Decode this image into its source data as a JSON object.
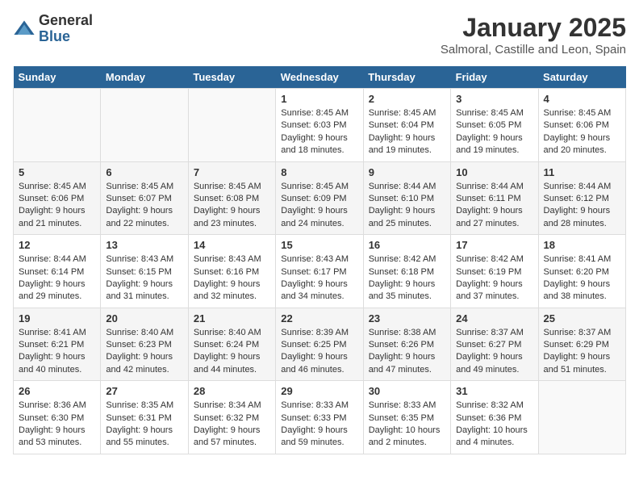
{
  "logo": {
    "general": "General",
    "blue": "Blue"
  },
  "title": "January 2025",
  "location": "Salmoral, Castille and Leon, Spain",
  "days_header": [
    "Sunday",
    "Monday",
    "Tuesday",
    "Wednesday",
    "Thursday",
    "Friday",
    "Saturday"
  ],
  "weeks": [
    [
      {
        "day": "",
        "info": ""
      },
      {
        "day": "",
        "info": ""
      },
      {
        "day": "",
        "info": ""
      },
      {
        "day": "1",
        "info": "Sunrise: 8:45 AM\nSunset: 6:03 PM\nDaylight: 9 hours\nand 18 minutes."
      },
      {
        "day": "2",
        "info": "Sunrise: 8:45 AM\nSunset: 6:04 PM\nDaylight: 9 hours\nand 19 minutes."
      },
      {
        "day": "3",
        "info": "Sunrise: 8:45 AM\nSunset: 6:05 PM\nDaylight: 9 hours\nand 19 minutes."
      },
      {
        "day": "4",
        "info": "Sunrise: 8:45 AM\nSunset: 6:06 PM\nDaylight: 9 hours\nand 20 minutes."
      }
    ],
    [
      {
        "day": "5",
        "info": "Sunrise: 8:45 AM\nSunset: 6:06 PM\nDaylight: 9 hours\nand 21 minutes."
      },
      {
        "day": "6",
        "info": "Sunrise: 8:45 AM\nSunset: 6:07 PM\nDaylight: 9 hours\nand 22 minutes."
      },
      {
        "day": "7",
        "info": "Sunrise: 8:45 AM\nSunset: 6:08 PM\nDaylight: 9 hours\nand 23 minutes."
      },
      {
        "day": "8",
        "info": "Sunrise: 8:45 AM\nSunset: 6:09 PM\nDaylight: 9 hours\nand 24 minutes."
      },
      {
        "day": "9",
        "info": "Sunrise: 8:44 AM\nSunset: 6:10 PM\nDaylight: 9 hours\nand 25 minutes."
      },
      {
        "day": "10",
        "info": "Sunrise: 8:44 AM\nSunset: 6:11 PM\nDaylight: 9 hours\nand 27 minutes."
      },
      {
        "day": "11",
        "info": "Sunrise: 8:44 AM\nSunset: 6:12 PM\nDaylight: 9 hours\nand 28 minutes."
      }
    ],
    [
      {
        "day": "12",
        "info": "Sunrise: 8:44 AM\nSunset: 6:14 PM\nDaylight: 9 hours\nand 29 minutes."
      },
      {
        "day": "13",
        "info": "Sunrise: 8:43 AM\nSunset: 6:15 PM\nDaylight: 9 hours\nand 31 minutes."
      },
      {
        "day": "14",
        "info": "Sunrise: 8:43 AM\nSunset: 6:16 PM\nDaylight: 9 hours\nand 32 minutes."
      },
      {
        "day": "15",
        "info": "Sunrise: 8:43 AM\nSunset: 6:17 PM\nDaylight: 9 hours\nand 34 minutes."
      },
      {
        "day": "16",
        "info": "Sunrise: 8:42 AM\nSunset: 6:18 PM\nDaylight: 9 hours\nand 35 minutes."
      },
      {
        "day": "17",
        "info": "Sunrise: 8:42 AM\nSunset: 6:19 PM\nDaylight: 9 hours\nand 37 minutes."
      },
      {
        "day": "18",
        "info": "Sunrise: 8:41 AM\nSunset: 6:20 PM\nDaylight: 9 hours\nand 38 minutes."
      }
    ],
    [
      {
        "day": "19",
        "info": "Sunrise: 8:41 AM\nSunset: 6:21 PM\nDaylight: 9 hours\nand 40 minutes."
      },
      {
        "day": "20",
        "info": "Sunrise: 8:40 AM\nSunset: 6:23 PM\nDaylight: 9 hours\nand 42 minutes."
      },
      {
        "day": "21",
        "info": "Sunrise: 8:40 AM\nSunset: 6:24 PM\nDaylight: 9 hours\nand 44 minutes."
      },
      {
        "day": "22",
        "info": "Sunrise: 8:39 AM\nSunset: 6:25 PM\nDaylight: 9 hours\nand 46 minutes."
      },
      {
        "day": "23",
        "info": "Sunrise: 8:38 AM\nSunset: 6:26 PM\nDaylight: 9 hours\nand 47 minutes."
      },
      {
        "day": "24",
        "info": "Sunrise: 8:37 AM\nSunset: 6:27 PM\nDaylight: 9 hours\nand 49 minutes."
      },
      {
        "day": "25",
        "info": "Sunrise: 8:37 AM\nSunset: 6:29 PM\nDaylight: 9 hours\nand 51 minutes."
      }
    ],
    [
      {
        "day": "26",
        "info": "Sunrise: 8:36 AM\nSunset: 6:30 PM\nDaylight: 9 hours\nand 53 minutes."
      },
      {
        "day": "27",
        "info": "Sunrise: 8:35 AM\nSunset: 6:31 PM\nDaylight: 9 hours\nand 55 minutes."
      },
      {
        "day": "28",
        "info": "Sunrise: 8:34 AM\nSunset: 6:32 PM\nDaylight: 9 hours\nand 57 minutes."
      },
      {
        "day": "29",
        "info": "Sunrise: 8:33 AM\nSunset: 6:33 PM\nDaylight: 9 hours\nand 59 minutes."
      },
      {
        "day": "30",
        "info": "Sunrise: 8:33 AM\nSunset: 6:35 PM\nDaylight: 10 hours\nand 2 minutes."
      },
      {
        "day": "31",
        "info": "Sunrise: 8:32 AM\nSunset: 6:36 PM\nDaylight: 10 hours\nand 4 minutes."
      },
      {
        "day": "",
        "info": ""
      }
    ]
  ]
}
